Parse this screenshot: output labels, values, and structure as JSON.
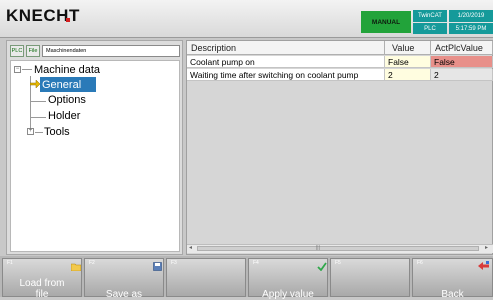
{
  "header": {
    "logo": "KNECHT",
    "mode": "MANUAL",
    "twincat": "TwinCAT",
    "plc": "PLC",
    "date": "1/20/2019",
    "time": "5:17:59 PM"
  },
  "left_panel": {
    "plc_button": "PLC",
    "file_button": "File",
    "path": "Maschinendaten",
    "tree": {
      "root": "Machine data",
      "items": [
        "General",
        "Options",
        "Holder",
        "Tools"
      ]
    }
  },
  "table": {
    "columns": [
      "Description",
      "Value",
      "ActPlcValue"
    ],
    "rows": [
      [
        "Coolant pump on",
        "False",
        "False"
      ],
      [
        "Waiting time after switching on coolant pump",
        "2",
        "2"
      ]
    ]
  },
  "softkeys": [
    {
      "fkey": "F1",
      "label": "Load from\nfile",
      "icon": "folder-icon"
    },
    {
      "fkey": "F2",
      "label": "Save as",
      "icon": "save-icon"
    },
    {
      "fkey": "F3",
      "label": "",
      "icon": ""
    },
    {
      "fkey": "F4",
      "label": "Apply value",
      "icon": "checkmark-icon"
    },
    {
      "fkey": "F5",
      "label": "",
      "icon": ""
    },
    {
      "fkey": "F6",
      "label": "Back",
      "icon": "back-arrow-icon"
    }
  ],
  "colors": {
    "mode_badge": "#22a33a",
    "status_badge": "#159a9a",
    "selection": "#2a7ab8",
    "value_cell": "#fffde0",
    "actual_value_mismatch": "#e8908a"
  }
}
